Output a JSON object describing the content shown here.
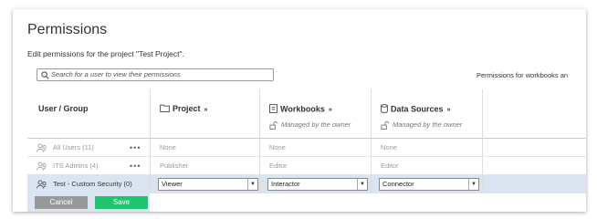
{
  "page": {
    "title": "Permissions",
    "subtitle": "Edit permissions for the project \"Test Project\"."
  },
  "search": {
    "placeholder": "Search for a user to view their permissions",
    "icon": "search-icon"
  },
  "permissions_for": "Permissions for workbooks an",
  "columns": {
    "user_group": "User / Group",
    "project": {
      "label": "Project",
      "icon": "folder-icon"
    },
    "workbooks": {
      "label": "Workbooks",
      "icon": "workbook-icon",
      "note": "Managed by the owner"
    },
    "data_sources": {
      "label": "Data Sources",
      "icon": "database-icon",
      "note": "Managed by the owner"
    },
    "expand_glyph": "»"
  },
  "rows": [
    {
      "name": "All Users (11)",
      "more": "•••",
      "project": "None",
      "workbooks": "None",
      "data_sources": "None",
      "state": "dim"
    },
    {
      "name": "ITS Admins (4)",
      "more": "•••",
      "project": "Publisher",
      "workbooks": "Editor",
      "data_sources": "Editor",
      "state": "dim"
    },
    {
      "name": "Test - Custom Security (0)",
      "project": "Viewer",
      "workbooks": "Interactor",
      "data_sources": "Connector",
      "state": "selected"
    }
  ],
  "actions": {
    "cancel": "Cancel",
    "save": "Save"
  },
  "colors": {
    "selected_row": "#dbe5f1",
    "save": "#1ec46e",
    "cancel": "#999999"
  }
}
